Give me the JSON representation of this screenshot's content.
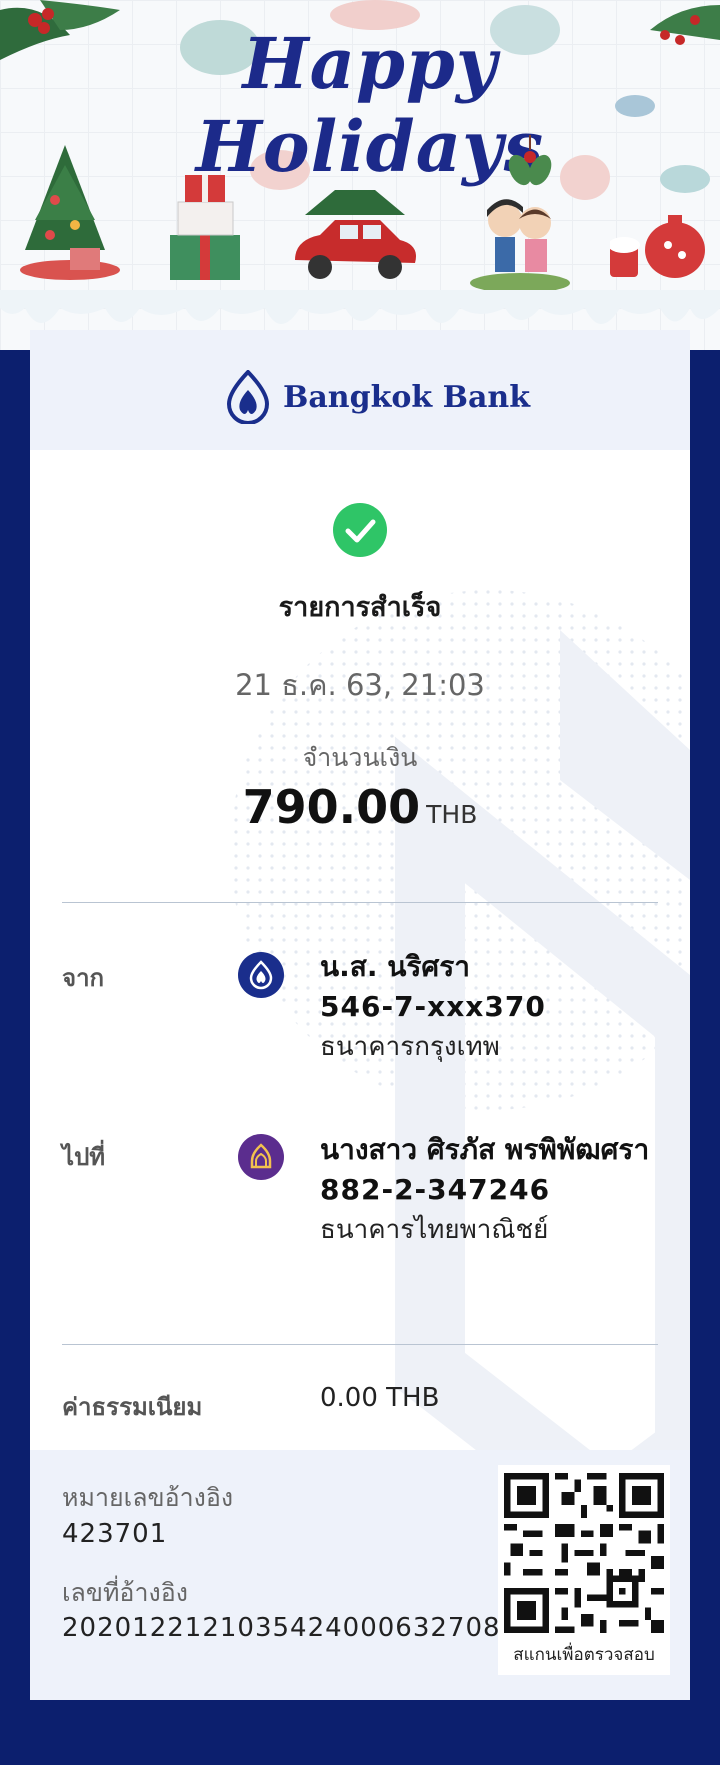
{
  "banner": {
    "headline": "Happy Holidays"
  },
  "bank": {
    "name": "Bangkok Bank",
    "brand_color": "#1a2e8c"
  },
  "transaction": {
    "status": "รายการสำเร็จ",
    "datetime": "21 ธ.ค. 63, 21:03",
    "amount_label": "จำนวนเงิน",
    "amount": "790.00",
    "currency": "THB"
  },
  "from": {
    "label": "จาก",
    "name": "น.ส. นริศรา",
    "account": "546-7-xxx370",
    "bank": "ธนาคารกรุงเทพ",
    "icon": "bangkok-bank-icon"
  },
  "to": {
    "label": "ไปที่",
    "name": "นางสาว ศิรภัส พรพิพัฒศรา",
    "account": "882-2-347246",
    "bank": "ธนาคารไทยพาณิชย์",
    "icon": "scb-bank-icon"
  },
  "fee": {
    "label": "ค่าธรรมเนียม",
    "value": "0.00 THB"
  },
  "reference": {
    "ref_no_label": "หมายเลขอ้างอิง",
    "ref_no": "423701",
    "ref_id_label": "เลขที่อ้างอิง",
    "ref_id": "2020122121035424000632708",
    "qr_caption": "สแกนเพื่อตรวจสอบ"
  },
  "colors": {
    "page_bg": "#0c1f6e",
    "success": "#2fc567",
    "scb_purple": "#5b2d8e"
  }
}
